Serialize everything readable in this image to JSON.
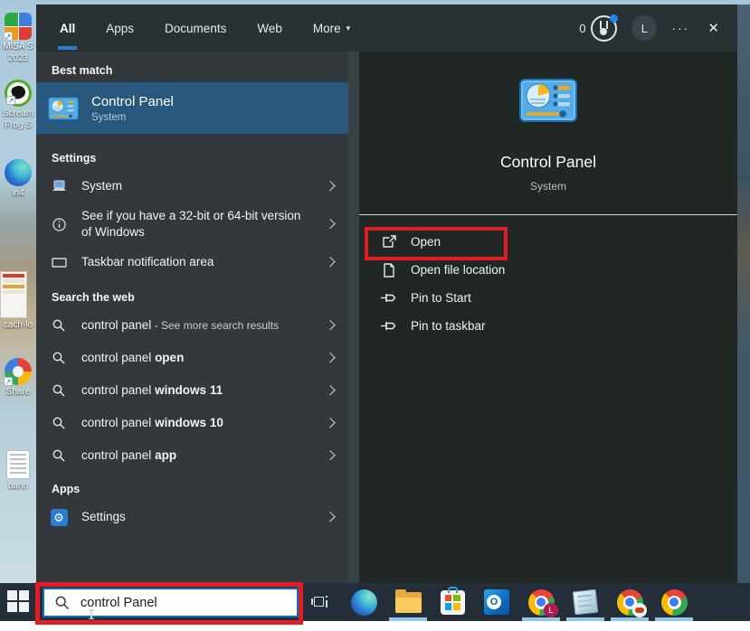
{
  "tabs": {
    "items": [
      {
        "label": "All",
        "active": true
      },
      {
        "label": "Apps",
        "active": false
      },
      {
        "label": "Documents",
        "active": false
      },
      {
        "label": "Web",
        "active": false
      },
      {
        "label": "More",
        "active": false,
        "has_dropdown": true
      }
    ]
  },
  "topbar": {
    "rewards_count": "0",
    "avatar_initial": "L"
  },
  "icons": {
    "caret_down": "▾",
    "ellipsis": "···",
    "close": "✕",
    "gear": "⚙"
  },
  "left": {
    "best_match_header": "Best match",
    "best_match": {
      "title": "Control Panel",
      "subtitle": "System"
    },
    "settings_header": "Settings",
    "settings_items": [
      {
        "label": "System",
        "icon": "laptop-icon"
      },
      {
        "label": "See if you have a 32-bit or 64-bit version of Windows",
        "icon": "info-icon"
      },
      {
        "label": "Taskbar notification area",
        "icon": "taskbar-rect-icon"
      }
    ],
    "web_header": "Search the web",
    "web_items": [
      {
        "query": "control panel",
        "suffix": " - See more search results",
        "bold": ""
      },
      {
        "query": "control panel ",
        "suffix": "",
        "bold": "open"
      },
      {
        "query": "control panel ",
        "suffix": "",
        "bold": "windows 11"
      },
      {
        "query": "control panel ",
        "suffix": "",
        "bold": "windows 10"
      },
      {
        "query": "control panel ",
        "suffix": "",
        "bold": "app"
      }
    ],
    "apps_header": "Apps",
    "apps_items": [
      {
        "label": "Settings",
        "icon": "gear-icon"
      }
    ]
  },
  "preview": {
    "title": "Control Panel",
    "subtitle": "System",
    "actions": [
      {
        "label": "Open",
        "icon": "open-icon",
        "annotated": true
      },
      {
        "label": "Open file location",
        "icon": "folder-location-icon",
        "annotated": false
      },
      {
        "label": "Pin to Start",
        "icon": "pin-icon",
        "annotated": false
      },
      {
        "label": "Pin to taskbar",
        "icon": "pin-icon",
        "annotated": false
      }
    ]
  },
  "search": {
    "value": "control Panel"
  },
  "taskbar": {
    "chrome_badge_initial": "L",
    "items": [
      {
        "name": "task-view",
        "underline": false
      },
      {
        "name": "edge",
        "underline": false
      },
      {
        "name": "file-explorer",
        "underline": true
      },
      {
        "name": "microsoft-store",
        "underline": false
      },
      {
        "name": "outlook",
        "underline": false
      },
      {
        "name": "chrome-profile-l",
        "underline": true
      },
      {
        "name": "notepad",
        "underline": true
      },
      {
        "name": "chrome-profile-2",
        "underline": true
      },
      {
        "name": "chrome",
        "underline": true
      }
    ]
  },
  "desktop_icons": [
    {
      "label": "MISA S",
      "label2": "2023"
    },
    {
      "label": "Scream",
      "label2": "Frog S"
    },
    {
      "label": "in4",
      "label2": ""
    },
    {
      "label": "cach-lo",
      "label2": ""
    },
    {
      "label": "Share",
      "label2": ""
    },
    {
      "label": "bann",
      "label2": ""
    }
  ],
  "colors": {
    "accent_blue": "#2b7cd3",
    "highlight_row": "#28587e",
    "annotation_red": "#e11d23",
    "search_border": "#0c6cbf",
    "panel_dark": "#212724",
    "panel_mid": "#32383c"
  }
}
